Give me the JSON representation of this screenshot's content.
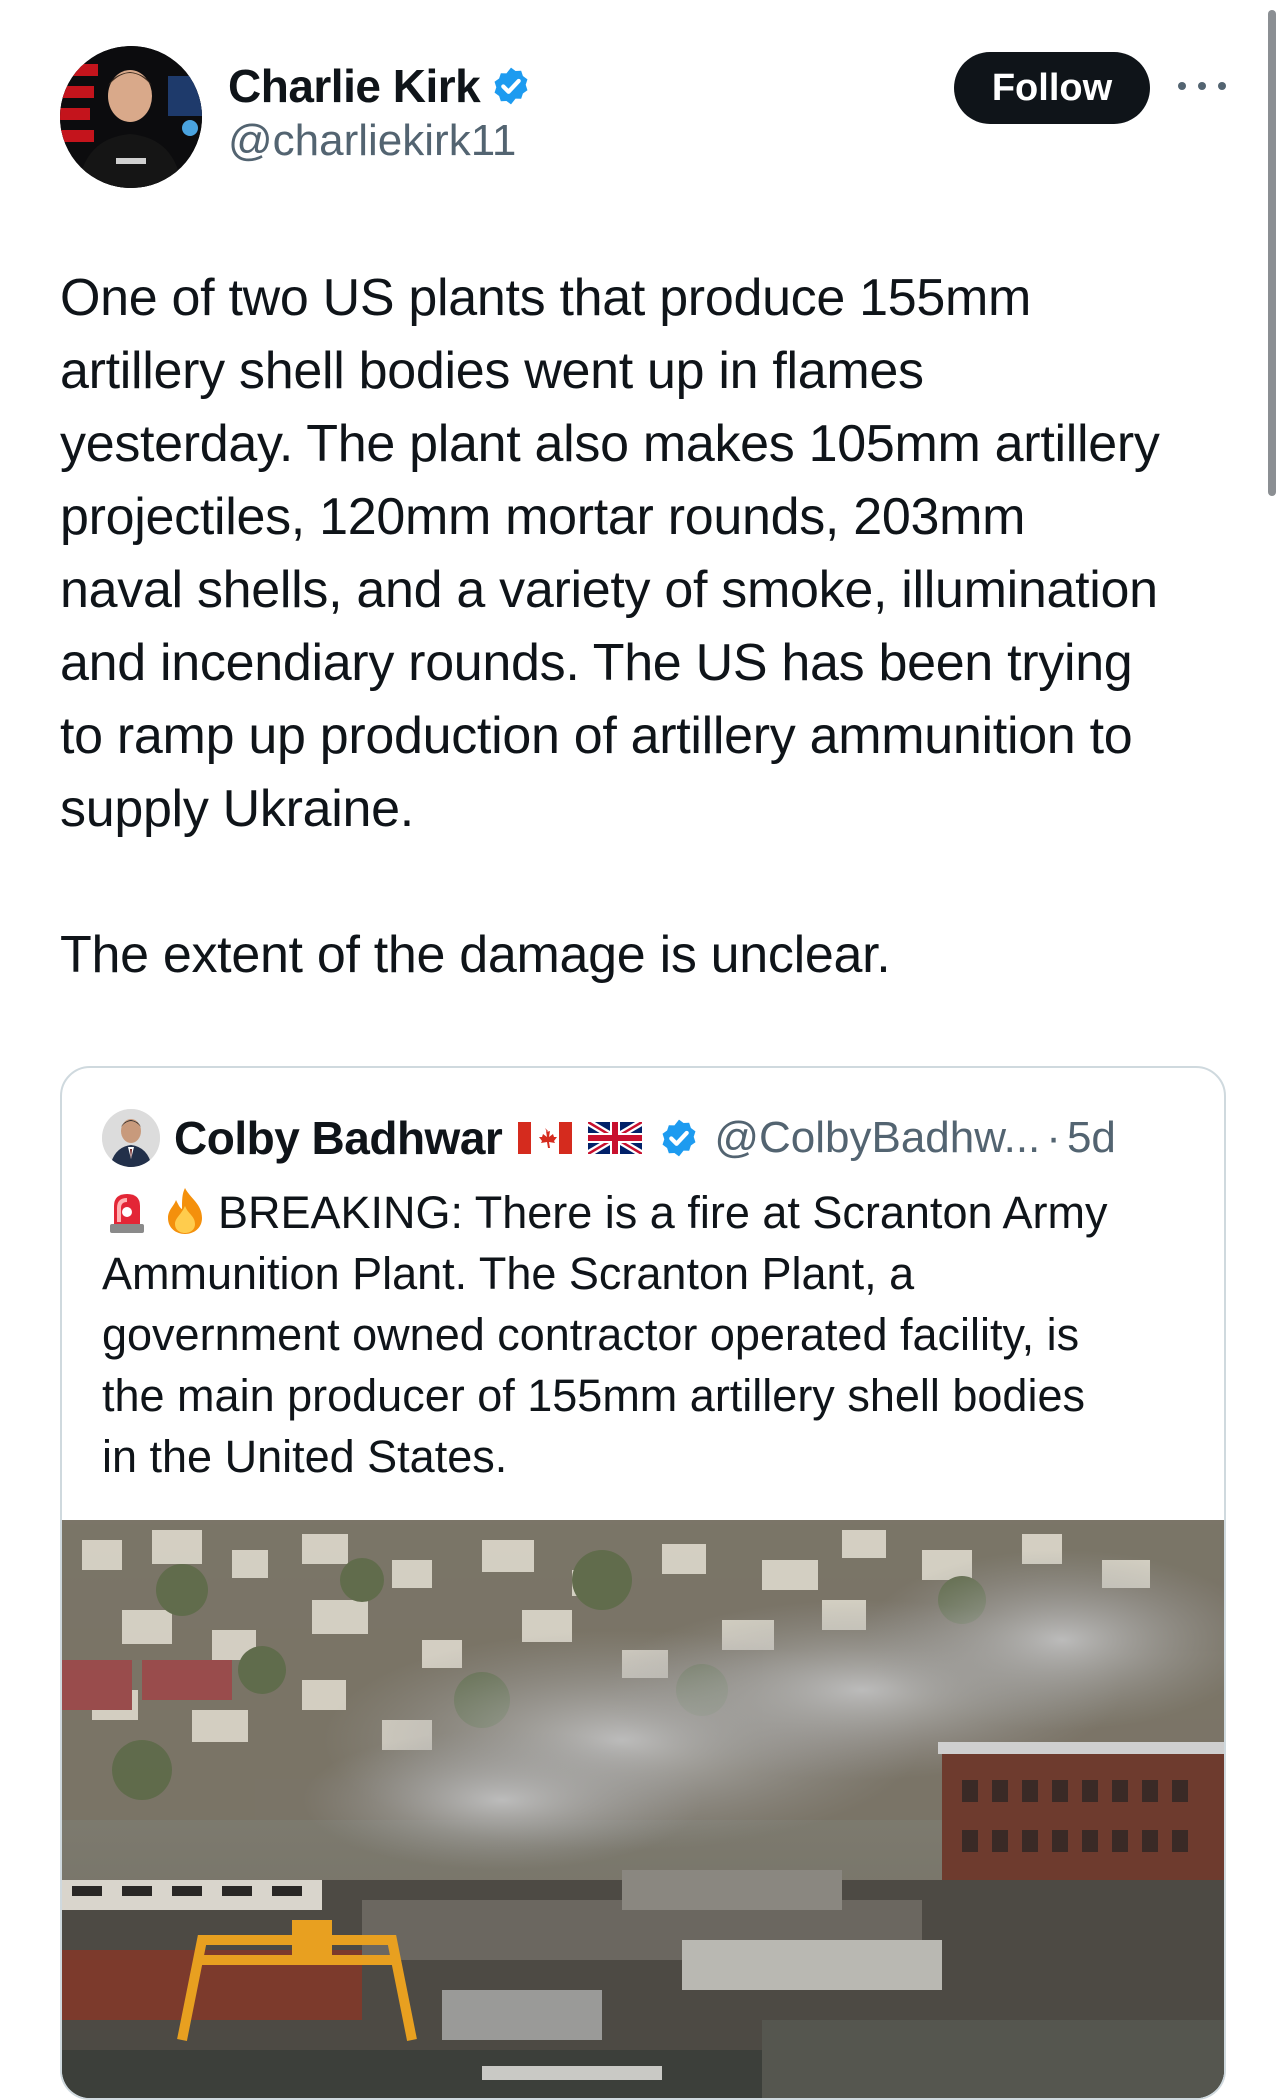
{
  "post": {
    "author_name": "Charlie Kirk",
    "author_handle": "@charliekirk11",
    "follow_label": "Follow",
    "paragraphs": [
      "One of two US plants that produce 155mm\nartillery shell bodies went up in flames\nyesterday. The plant also makes 105mm artillery\nprojectiles, 120mm mortar rounds, 203mm\nnaval shells, and a variety of smoke, illumination\nand incendiary rounds. The US has been trying\nto ramp up production of artillery ammunition to\nsupply Ukraine.",
      "The extent of the damage is unclear."
    ]
  },
  "quote": {
    "author_name": "Colby Badhwar",
    "author_handle": "@ColbyBadhw...",
    "separator": "·",
    "time": "5d",
    "text": "BREAKING: There is a fire at Scranton Army\nAmmunition Plant. The Scranton Plant, a\ngovernment owned contractor operated facility, is\nthe main producer of 155mm artillery shell bodies\nin the United States.",
    "emojis": [
      "police-light-icon",
      "fire-icon"
    ],
    "flags": [
      "canada-flag-icon",
      "uk-flag-icon"
    ]
  },
  "colors": {
    "text": "#0f1419",
    "secondary": "#536471",
    "verified": "#1d9bf0",
    "border": "#cfd9de"
  }
}
